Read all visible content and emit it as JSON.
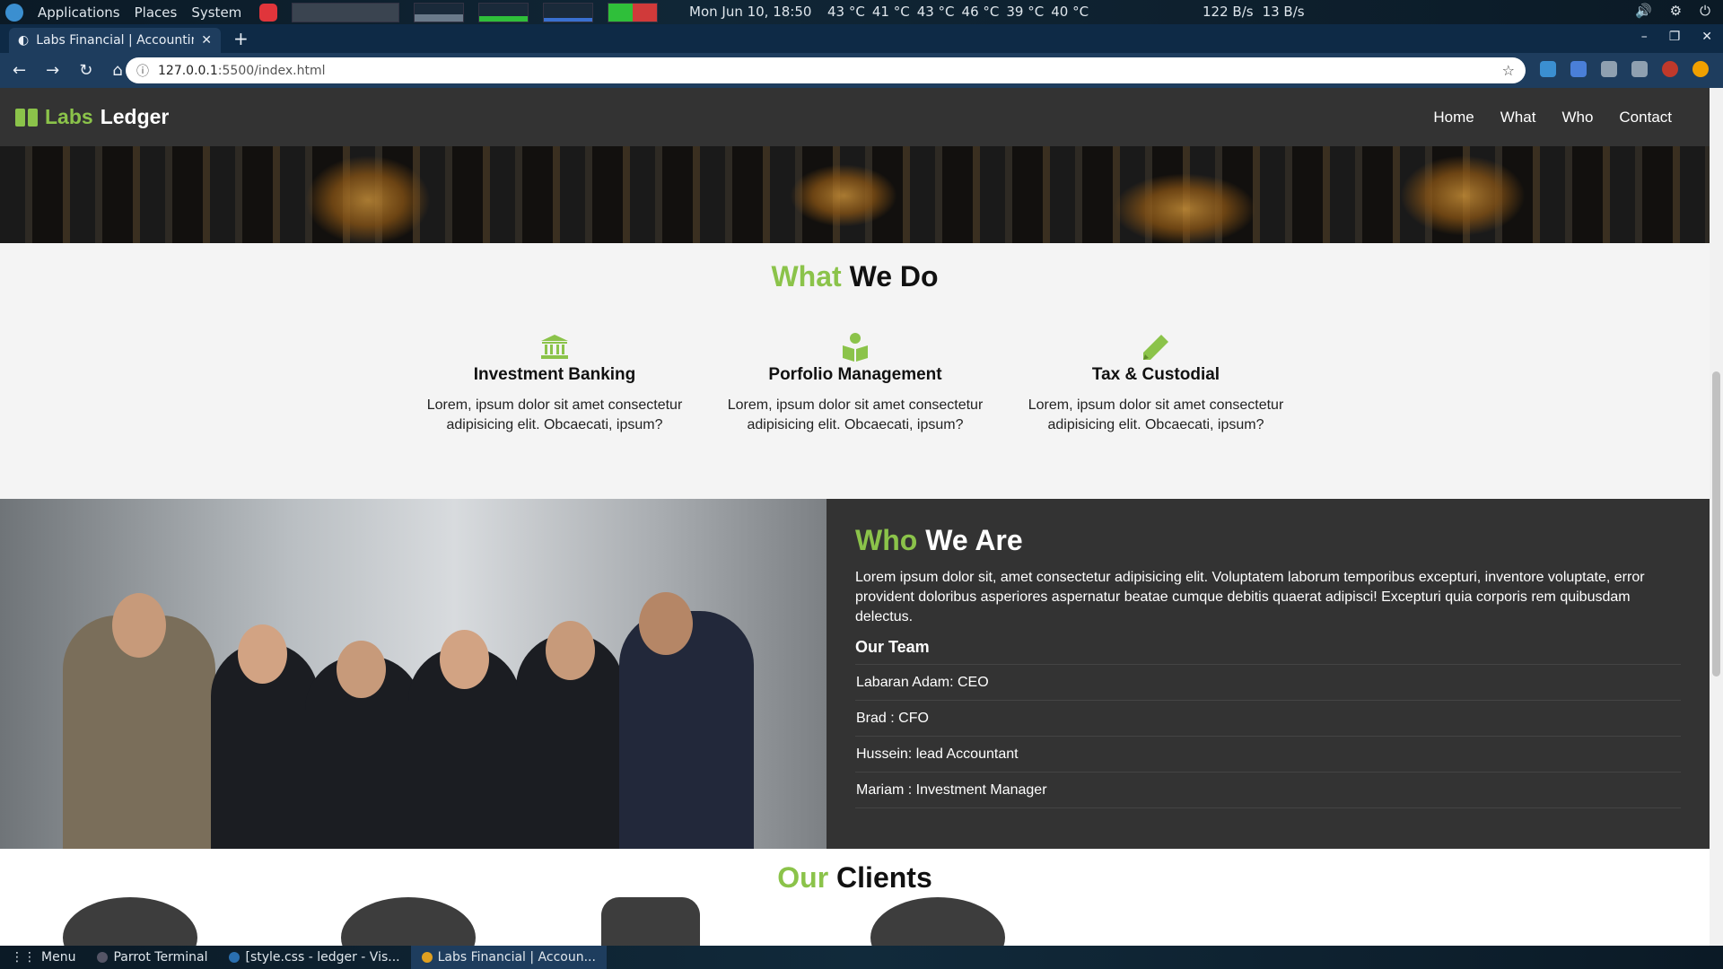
{
  "system_panel": {
    "menus": [
      "Applications",
      "Places",
      "System"
    ],
    "clock": "Mon Jun 10, 18:50",
    "temps": [
      "43 °C",
      "41 °C",
      "43 °C",
      "46 °C",
      "39 °C",
      "40 °C"
    ],
    "net_down": "122 B/s",
    "net_up": "13 B/s"
  },
  "browser": {
    "tab_title": "Labs Financial | Accountin",
    "url_host": "127.0.0.1",
    "url_path": ":5500/index.html"
  },
  "site": {
    "brand_part1": "Labs",
    "brand_part2": "Ledger",
    "nav": [
      "Home",
      "What",
      "Who",
      "Contact"
    ],
    "services_title_accent": "What",
    "services_title_rest": "We Do",
    "services": [
      {
        "title": "Investment Banking",
        "text": "Lorem, ipsum dolor sit amet consectetur adipisicing elit. Obcaecati, ipsum?",
        "icon": "bank-icon"
      },
      {
        "title": "Porfolio Management",
        "text": "Lorem, ipsum dolor sit amet consectetur adipisicing elit. Obcaecati, ipsum?",
        "icon": "book-reader-icon"
      },
      {
        "title": "Tax & Custodial",
        "text": "Lorem, ipsum dolor sit amet consectetur adipisicing elit. Obcaecati, ipsum?",
        "icon": "pencil-icon"
      }
    ],
    "about_title_accent": "Who",
    "about_title_rest": "We Are",
    "about_text": "Lorem ipsum dolor sit, amet consectetur adipisicing elit. Voluptatem laborum temporibus excepturi, inventore voluptate, error provident doloribus asperiores aspernatur beatae cumque debitis quaerat adipisci! Excepturi quia corporis rem quibusdam delectus.",
    "team_heading": "Our Team",
    "team": [
      "Labaran Adam: CEO",
      "Brad : CFO",
      "Hussein: lead Accountant",
      "Mariam : Investment Manager"
    ],
    "clients_title_accent": "Our",
    "clients_title_rest": "Clients"
  },
  "taskbar": {
    "menu_label": "Menu",
    "tasks": [
      "Parrot Terminal",
      "[style.css - ledger - Vis...",
      "Labs Financial | Accoun..."
    ]
  },
  "colors": {
    "accent": "#8bc34a",
    "header_bg": "#333333"
  }
}
